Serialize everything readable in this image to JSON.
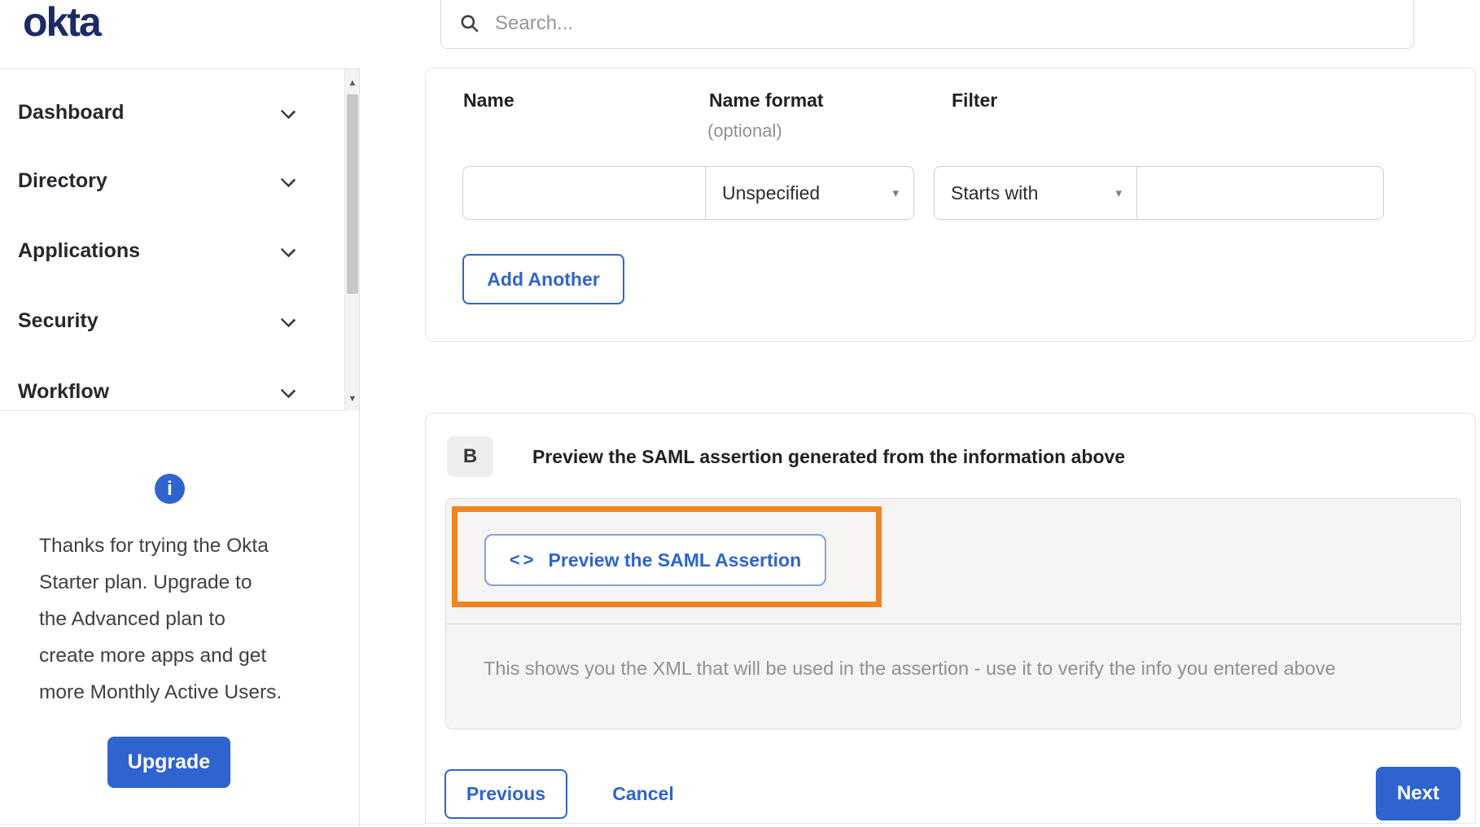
{
  "header": {
    "logo_text": "okta",
    "search_placeholder": "Search..."
  },
  "sidebar": {
    "items": [
      {
        "label": "Dashboard"
      },
      {
        "label": "Directory"
      },
      {
        "label": "Applications"
      },
      {
        "label": "Security"
      },
      {
        "label": "Workflow"
      }
    ]
  },
  "upgrade_panel": {
    "lines": [
      "Thanks for trying the Okta",
      "Starter plan. Upgrade to",
      "the Advanced plan to",
      "create more apps and get",
      "more Monthly Active Users."
    ],
    "button_label": "Upgrade"
  },
  "attribute_form": {
    "name_label": "Name",
    "name_format_label": "Name format",
    "name_format_sublabel": "(optional)",
    "filter_label": "Filter",
    "name_value": "",
    "name_format_selected": "Unspecified",
    "filter_operator_selected": "Starts with",
    "filter_value": "",
    "add_another_label": "Add Another"
  },
  "preview_section": {
    "badge": "B",
    "title": "Preview the SAML assertion generated from the information above",
    "preview_button_label": "Preview the SAML Assertion",
    "description": "This shows you the XML that will be used in the assertion - use it to verify the info you entered above"
  },
  "footer": {
    "previous_label": "Previous",
    "cancel_label": "Cancel",
    "next_label": "Next"
  },
  "icons": {
    "info": "i",
    "code": "<>",
    "select_caret": "▾",
    "scroll_up": "▲",
    "scroll_down": "▼"
  },
  "colors": {
    "accent_blue": "#2f64cf",
    "logo_navy": "#1b2b66",
    "highlight_orange": "#ef8425"
  }
}
